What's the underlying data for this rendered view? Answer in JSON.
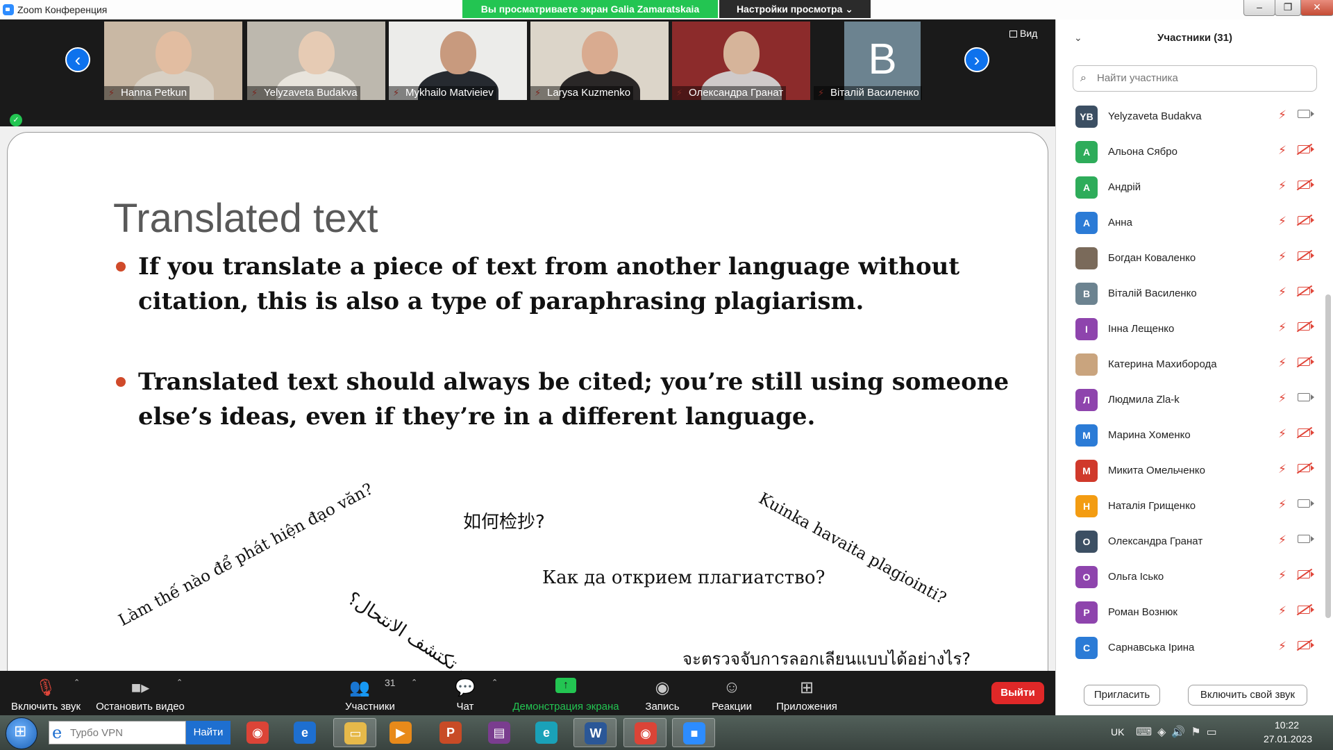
{
  "window": {
    "title": "Zoom Конференция",
    "share_banner": "Вы просматриваете экран Galia Zamaratskaia",
    "view_settings": "Настройки просмотра ⌄",
    "controls": [
      "–",
      "❐",
      "✕"
    ]
  },
  "video_strip": {
    "view_label": "Вид",
    "participants": [
      {
        "name": "Hanna Petkun",
        "bg": "#c9b8a4",
        "skin": "#e2bda1",
        "shirt": "#d8d0c4"
      },
      {
        "name": "Yelyzaveta Budakva",
        "bg": "#bdb8ae",
        "skin": "#e6cbb4",
        "shirt": "#e8e4dc"
      },
      {
        "name": "Mykhailo Matvieiev",
        "bg": "#ececea",
        "skin": "#c89a7e",
        "shirt": "#262a30"
      },
      {
        "name": "Larysa Kuzmenko",
        "bg": "#dcd5c9",
        "skin": "#d9ab90",
        "shirt": "#2a2727"
      },
      {
        "name": "Олександра Гранат",
        "bg": "#8c2b2b",
        "skin": "#d6b49a",
        "shirt": "#cfcaca"
      },
      {
        "name": "Віталій Василенко",
        "initial": "B"
      }
    ]
  },
  "slide": {
    "title": "Translated text",
    "bullets": [
      "If you translate a piece of text from another language without citation, this is also a type of paraphrasing plagiarism.",
      "Translated text should always be cited; you’re still using someone else’s ideas, even if they’re in a different language."
    ],
    "phrases": {
      "vi": "Làm thế nào để phát hiện đạo văn?",
      "zh": "如何检抄?",
      "fi": "Kuinka havaita plagiointi?",
      "bg": "Как да открием плагиатство?",
      "ar": "كيف تكتشف الانتحال؟",
      "th": "จะตรวจจับการลอกเลียนแบบได้อย่างไร?"
    }
  },
  "toolbar": {
    "audio": "Включить звук",
    "video": "Остановить видео",
    "participants": "Участники",
    "participants_count": "31",
    "chat": "Чат",
    "share": "Демонстрация экрана",
    "record": "Запись",
    "reactions": "Реакции",
    "apps": "Приложения",
    "leave": "Выйти"
  },
  "panel": {
    "title": "Участники (31)",
    "search_placeholder": "Найти участника",
    "invite": "Пригласить",
    "unmute_self": "Включить свой звук",
    "participants": [
      {
        "name": "Yelyzaveta Budakva",
        "initials": "YB",
        "color": "#3c4f63",
        "cam": "on"
      },
      {
        "name": "Альона Сябро",
        "initials": "А",
        "color": "#2eac5a",
        "cam": "off"
      },
      {
        "name": "Андрій",
        "initials": "А",
        "color": "#2eac5a",
        "cam": "off"
      },
      {
        "name": "Анна",
        "initials": "А",
        "color": "#2b7bd6",
        "cam": "off"
      },
      {
        "name": "Богдан Коваленко",
        "initials": "",
        "color": "#7a6a5a",
        "cam": "off"
      },
      {
        "name": "Віталій Василенко",
        "initials": "В",
        "color": "#6c8390",
        "cam": "off"
      },
      {
        "name": "Інна Лещенко",
        "initials": "І",
        "color": "#8e44ad",
        "cam": "off"
      },
      {
        "name": "Катерина Махиборода",
        "initials": "",
        "color": "#c9a47e",
        "cam": "off"
      },
      {
        "name": "Людмила Zla-k",
        "initials": "Л",
        "color": "#8e44ad",
        "cam": "on"
      },
      {
        "name": "Марина Хоменко",
        "initials": "М",
        "color": "#2b7bd6",
        "cam": "off"
      },
      {
        "name": "Микита Омельченко",
        "initials": "М",
        "color": "#d0392b",
        "cam": "off"
      },
      {
        "name": "Наталія Грищенко",
        "initials": "Н",
        "color": "#f39c12",
        "cam": "on"
      },
      {
        "name": "Олександра Гранат",
        "initials": "О",
        "color": "#3c4f63",
        "cam": "on"
      },
      {
        "name": "Ольга Ісько",
        "initials": "О",
        "color": "#8e44ad",
        "cam": "off"
      },
      {
        "name": "Роман Вознюк",
        "initials": "Р",
        "color": "#8e44ad",
        "cam": "off"
      },
      {
        "name": "Сарнавська Ірина",
        "initials": "С",
        "color": "#2b7bd6",
        "cam": "off"
      }
    ]
  },
  "taskbar": {
    "search_placeholder": "Турбо VPN",
    "search_button": "Найти",
    "apps": [
      {
        "name": "chrome",
        "glyph": "◉",
        "color": "#db4437"
      },
      {
        "name": "internet-explorer",
        "glyph": "e",
        "color": "#1e6fd0"
      },
      {
        "name": "file-explorer",
        "glyph": "▭",
        "color": "#e6b94a"
      },
      {
        "name": "media-player",
        "glyph": "▶",
        "color": "#e88a1a"
      },
      {
        "name": "powerpoint",
        "glyph": "P",
        "color": "#c84b26"
      },
      {
        "name": "winrar",
        "glyph": "▤",
        "color": "#7a3d8f"
      },
      {
        "name": "edge",
        "glyph": "e",
        "color": "#1aa1b8"
      },
      {
        "name": "word",
        "glyph": "W",
        "color": "#2b5797"
      },
      {
        "name": "chrome-active",
        "glyph": "◉",
        "color": "#db4437"
      },
      {
        "name": "zoom",
        "glyph": "■",
        "color": "#2d8cff"
      }
    ],
    "language": "UK",
    "time": "10:22",
    "date": "27.01.2023"
  }
}
